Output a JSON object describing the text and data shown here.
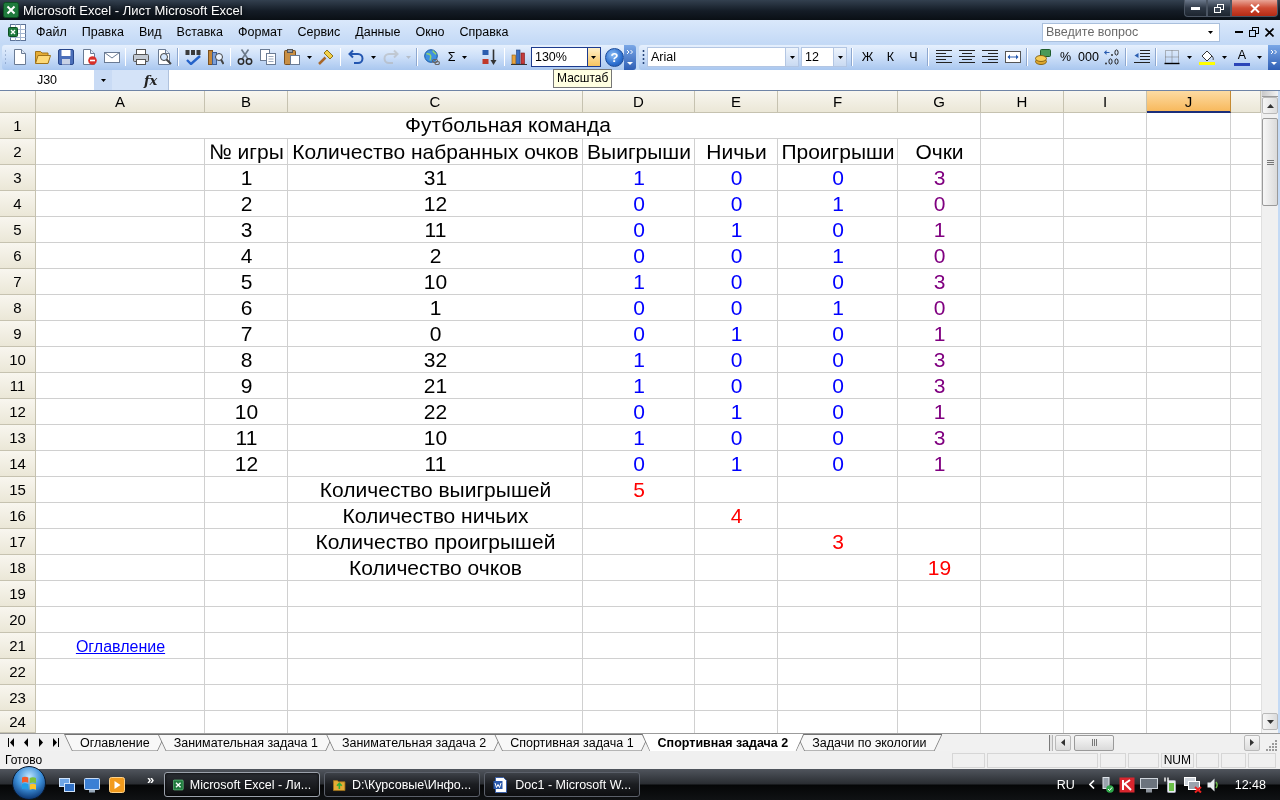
{
  "window": {
    "title": "Microsoft Excel - Лист Microsoft Excel"
  },
  "menu_bar": {
    "items": [
      "Файл",
      "Правка",
      "Вид",
      "Вставка",
      "Формат",
      "Сервис",
      "Данные",
      "Окно",
      "Справка"
    ],
    "question_box": {
      "placeholder": "Введите вопрос"
    }
  },
  "standard_toolbar": {
    "groups": [
      [
        {
          "kind": "new",
          "disabled": false
        },
        {
          "kind": "open",
          "disabled": false
        },
        {
          "kind": "save",
          "disabled": false
        },
        {
          "kind": "permission",
          "disabled": false
        },
        {
          "kind": "mail",
          "disabled": false
        }
      ],
      [
        {
          "kind": "print",
          "disabled": false
        },
        {
          "kind": "preview",
          "disabled": false
        }
      ],
      [
        {
          "kind": "spelling",
          "disabled": false
        },
        {
          "kind": "research",
          "disabled": false
        }
      ],
      [
        {
          "kind": "cut",
          "disabled": false
        },
        {
          "kind": "copy",
          "disabled": false
        },
        {
          "kind": "paste",
          "disabled": false,
          "menu": true
        },
        {
          "kind": "painter",
          "disabled": false
        }
      ],
      [
        {
          "kind": "undo",
          "disabled": false,
          "menu": true
        },
        {
          "kind": "redo",
          "disabled": true,
          "menu": true
        }
      ],
      [
        {
          "kind": "hyperlink",
          "disabled": false
        },
        {
          "kind": "sum",
          "label": "Σ",
          "disabled": false,
          "menu": true
        },
        {
          "kind": "sort",
          "disabled": false
        }
      ],
      [
        {
          "kind": "chart",
          "disabled": false
        },
        {
          "kind": "zoom",
          "value": "130%",
          "tooltip": "Масштаб",
          "disabled": false
        },
        {
          "kind": "help",
          "label": "?",
          "disabled": false
        }
      ]
    ]
  },
  "formatting_toolbar": {
    "groups": [
      [
        {
          "kind": "font",
          "value": "Arial"
        },
        {
          "kind": "size",
          "value": "12"
        }
      ],
      [
        {
          "kind": "bold",
          "label": "Ж"
        },
        {
          "kind": "italic",
          "label": "К"
        },
        {
          "kind": "underline",
          "label": "Ч"
        }
      ],
      [
        {
          "kind": "left"
        },
        {
          "kind": "center"
        },
        {
          "kind": "right"
        },
        {
          "kind": "merge"
        }
      ],
      [
        {
          "kind": "currency"
        },
        {
          "kind": "percent",
          "label": "%"
        },
        {
          "kind": "thousands",
          "label": "000"
        },
        {
          "kind": "decimal"
        }
      ],
      [
        {
          "kind": "indent"
        }
      ],
      [
        {
          "kind": "borders",
          "menu": true
        },
        {
          "kind": "fill",
          "menu": true
        },
        {
          "kind": "textcolor",
          "label": "A",
          "menu": true
        }
      ]
    ]
  },
  "formula_bar": {
    "name_box": "J30",
    "function_label": "fx"
  },
  "sheet": {
    "columns": [
      {
        "label": "A",
        "selected": false
      },
      {
        "label": "B",
        "selected": false
      },
      {
        "label": "C",
        "selected": false
      },
      {
        "label": "D",
        "selected": false
      },
      {
        "label": "E",
        "selected": false
      },
      {
        "label": "F",
        "selected": false
      },
      {
        "label": "G",
        "selected": false
      },
      {
        "label": "H",
        "selected": false
      },
      {
        "label": "I",
        "selected": false
      },
      {
        "label": "J",
        "selected": true
      }
    ],
    "rows": [
      {
        "header": "1",
        "title": "Футбольная команда"
      },
      {
        "header": "2",
        "cells": [
          null,
          {
            "text": "№ игры"
          },
          {
            "text": "Количество набранных очков"
          },
          {
            "text": "Выигрыши"
          },
          {
            "text": "Ничьи"
          },
          {
            "text": "Проигрыши"
          },
          {
            "text": "Очки"
          }
        ]
      },
      {
        "header": "3",
        "cells": [
          null,
          {
            "text": "1"
          },
          {
            "text": "31"
          },
          {
            "text": "1",
            "color": "#0000ff"
          },
          {
            "text": "0",
            "color": "#0000ff"
          },
          {
            "text": "0",
            "color": "#0000ff"
          },
          {
            "text": "3",
            "color": "#800080"
          }
        ]
      },
      {
        "header": "4",
        "cells": [
          null,
          {
            "text": "2"
          },
          {
            "text": "12"
          },
          {
            "text": "0",
            "color": "#0000ff"
          },
          {
            "text": "0",
            "color": "#0000ff"
          },
          {
            "text": "1",
            "color": "#0000ff"
          },
          {
            "text": "0",
            "color": "#800080"
          }
        ]
      },
      {
        "header": "5",
        "cells": [
          null,
          {
            "text": "3"
          },
          {
            "text": "11"
          },
          {
            "text": "0",
            "color": "#0000ff"
          },
          {
            "text": "1",
            "color": "#0000ff"
          },
          {
            "text": "0",
            "color": "#0000ff"
          },
          {
            "text": "1",
            "color": "#800080"
          }
        ]
      },
      {
        "header": "6",
        "cells": [
          null,
          {
            "text": "4"
          },
          {
            "text": "2"
          },
          {
            "text": "0",
            "color": "#0000ff"
          },
          {
            "text": "0",
            "color": "#0000ff"
          },
          {
            "text": "1",
            "color": "#0000ff"
          },
          {
            "text": "0",
            "color": "#800080"
          }
        ]
      },
      {
        "header": "7",
        "cells": [
          null,
          {
            "text": "5"
          },
          {
            "text": "10"
          },
          {
            "text": "1",
            "color": "#0000ff"
          },
          {
            "text": "0",
            "color": "#0000ff"
          },
          {
            "text": "0",
            "color": "#0000ff"
          },
          {
            "text": "3",
            "color": "#800080"
          }
        ]
      },
      {
        "header": "8",
        "cells": [
          null,
          {
            "text": "6"
          },
          {
            "text": "1"
          },
          {
            "text": "0",
            "color": "#0000ff"
          },
          {
            "text": "0",
            "color": "#0000ff"
          },
          {
            "text": "1",
            "color": "#0000ff"
          },
          {
            "text": "0",
            "color": "#800080"
          }
        ]
      },
      {
        "header": "9",
        "cells": [
          null,
          {
            "text": "7"
          },
          {
            "text": "0"
          },
          {
            "text": "0",
            "color": "#0000ff"
          },
          {
            "text": "1",
            "color": "#0000ff"
          },
          {
            "text": "0",
            "color": "#0000ff"
          },
          {
            "text": "1",
            "color": "#800080"
          }
        ]
      },
      {
        "header": "10",
        "cells": [
          null,
          {
            "text": "8"
          },
          {
            "text": "32"
          },
          {
            "text": "1",
            "color": "#0000ff"
          },
          {
            "text": "0",
            "color": "#0000ff"
          },
          {
            "text": "0",
            "color": "#0000ff"
          },
          {
            "text": "3",
            "color": "#800080"
          }
        ]
      },
      {
        "header": "11",
        "cells": [
          null,
          {
            "text": "9"
          },
          {
            "text": "21"
          },
          {
            "text": "1",
            "color": "#0000ff"
          },
          {
            "text": "0",
            "color": "#0000ff"
          },
          {
            "text": "0",
            "color": "#0000ff"
          },
          {
            "text": "3",
            "color": "#800080"
          }
        ]
      },
      {
        "header": "12",
        "cells": [
          null,
          {
            "text": "10"
          },
          {
            "text": "22"
          },
          {
            "text": "0",
            "color": "#0000ff"
          },
          {
            "text": "1",
            "color": "#0000ff"
          },
          {
            "text": "0",
            "color": "#0000ff"
          },
          {
            "text": "1",
            "color": "#800080"
          }
        ]
      },
      {
        "header": "13",
        "cells": [
          null,
          {
            "text": "11"
          },
          {
            "text": "10"
          },
          {
            "text": "1",
            "color": "#0000ff"
          },
          {
            "text": "0",
            "color": "#0000ff"
          },
          {
            "text": "0",
            "color": "#0000ff"
          },
          {
            "text": "3",
            "color": "#800080"
          }
        ]
      },
      {
        "header": "14",
        "cells": [
          null,
          {
            "text": "12"
          },
          {
            "text": "11"
          },
          {
            "text": "0",
            "color": "#0000ff"
          },
          {
            "text": "1",
            "color": "#0000ff"
          },
          {
            "text": "0",
            "color": "#0000ff"
          },
          {
            "text": "1",
            "color": "#800080"
          }
        ]
      },
      {
        "header": "15",
        "cells": [
          null,
          null,
          {
            "text": "Количество выигрышей"
          },
          {
            "text": "5",
            "color": "#ff0000"
          }
        ]
      },
      {
        "header": "16",
        "cells": [
          null,
          null,
          {
            "text": "Количество ничьих"
          },
          null,
          {
            "text": "4",
            "color": "#ff0000"
          }
        ]
      },
      {
        "header": "17",
        "cells": [
          null,
          null,
          {
            "text": "Количество проигрышей"
          },
          null,
          null,
          {
            "text": "3",
            "color": "#ff0000"
          }
        ]
      },
      {
        "header": "18",
        "cells": [
          null,
          null,
          {
            "text": "Количество очков"
          },
          null,
          null,
          null,
          {
            "text": "19",
            "color": "#ff0000"
          }
        ]
      },
      {
        "header": "19"
      },
      {
        "header": "20"
      },
      {
        "header": "21",
        "link": "Оглавление"
      },
      {
        "header": "22"
      },
      {
        "header": "23"
      },
      {
        "header": "24"
      }
    ]
  },
  "sheet_tabs": [
    {
      "label": "Оглавление",
      "selected": false
    },
    {
      "label": "Занимательная задача 1",
      "selected": false
    },
    {
      "label": "Занимательная задача 2",
      "selected": false
    },
    {
      "label": "Спортивная задача 1",
      "selected": false
    },
    {
      "label": "Спортивная задача 2",
      "selected": true
    },
    {
      "label": "Задачи по экологии",
      "selected": false
    }
  ],
  "status_bar": {
    "text": "Готово",
    "indicators": [
      "NUM"
    ]
  },
  "taskbar": {
    "more": "»",
    "tasks": [
      {
        "label": "Microsoft Excel - Ли...",
        "selected": true
      },
      {
        "label": "D:\\Курсовые\\Инфо...",
        "selected": false
      },
      {
        "label": "Doc1 - Microsoft W...",
        "selected": false
      }
    ],
    "language": "RU",
    "clock": "12:48"
  }
}
